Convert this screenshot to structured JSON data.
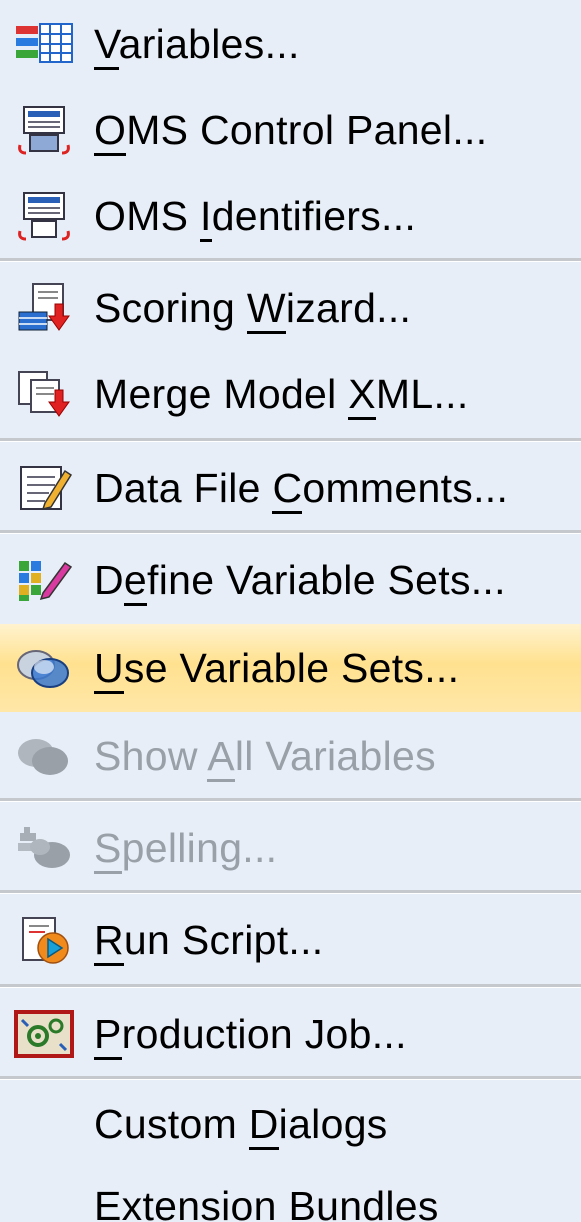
{
  "menu": {
    "items": [
      {
        "pre": "",
        "ul": "V",
        "post": "ariables...",
        "icon": "variables-grid-icon",
        "enabled": true
      },
      {
        "pre": "",
        "ul": "O",
        "post": "MS Control Panel...",
        "icon": "oms-control-panel-icon",
        "enabled": true
      },
      {
        "pre": "OMS ",
        "ul": "I",
        "post": "dentifiers...",
        "icon": "oms-identifiers-icon",
        "enabled": true
      },
      {
        "pre": "Scoring ",
        "ul": "W",
        "post": "izard...",
        "icon": "scoring-wizard-icon",
        "enabled": true
      },
      {
        "pre": "Merge Model ",
        "ul": "X",
        "post": "ML...",
        "icon": "merge-model-xml-icon",
        "enabled": true
      },
      {
        "pre": "Data File ",
        "ul": "C",
        "post": "omments...",
        "icon": "data-file-comments-icon",
        "enabled": true
      },
      {
        "pre": "D",
        "ul": "e",
        "post": "fine Variable Sets...",
        "icon": "define-variable-sets-icon",
        "enabled": true
      },
      {
        "pre": "",
        "ul": "U",
        "post": "se Variable Sets...",
        "icon": "use-variable-sets-icon",
        "enabled": true,
        "highlighted": true
      },
      {
        "pre": "Show ",
        "ul": "A",
        "post": "ll Variables",
        "icon": "show-all-variables-icon",
        "enabled": false
      },
      {
        "pre": "",
        "ul": "S",
        "post": "pelling...",
        "icon": "spelling-icon",
        "enabled": false
      },
      {
        "pre": "",
        "ul": "R",
        "post": "un Script...",
        "icon": "run-script-icon",
        "enabled": true
      },
      {
        "pre": "",
        "ul": "P",
        "post": "roduction Job...",
        "icon": "production-job-icon",
        "enabled": true
      },
      {
        "pre": "Custom ",
        "ul": "D",
        "post": "ialogs",
        "icon": "",
        "enabled": true
      },
      {
        "pre": "Extension Bundles",
        "ul": "",
        "post": "",
        "icon": "",
        "enabled": true
      }
    ]
  },
  "colors": {
    "menu_background": "#e8eef7",
    "highlight": "#ffe18f",
    "separator": "#c5c9ce",
    "disabled_text": "#9aa0a8"
  }
}
